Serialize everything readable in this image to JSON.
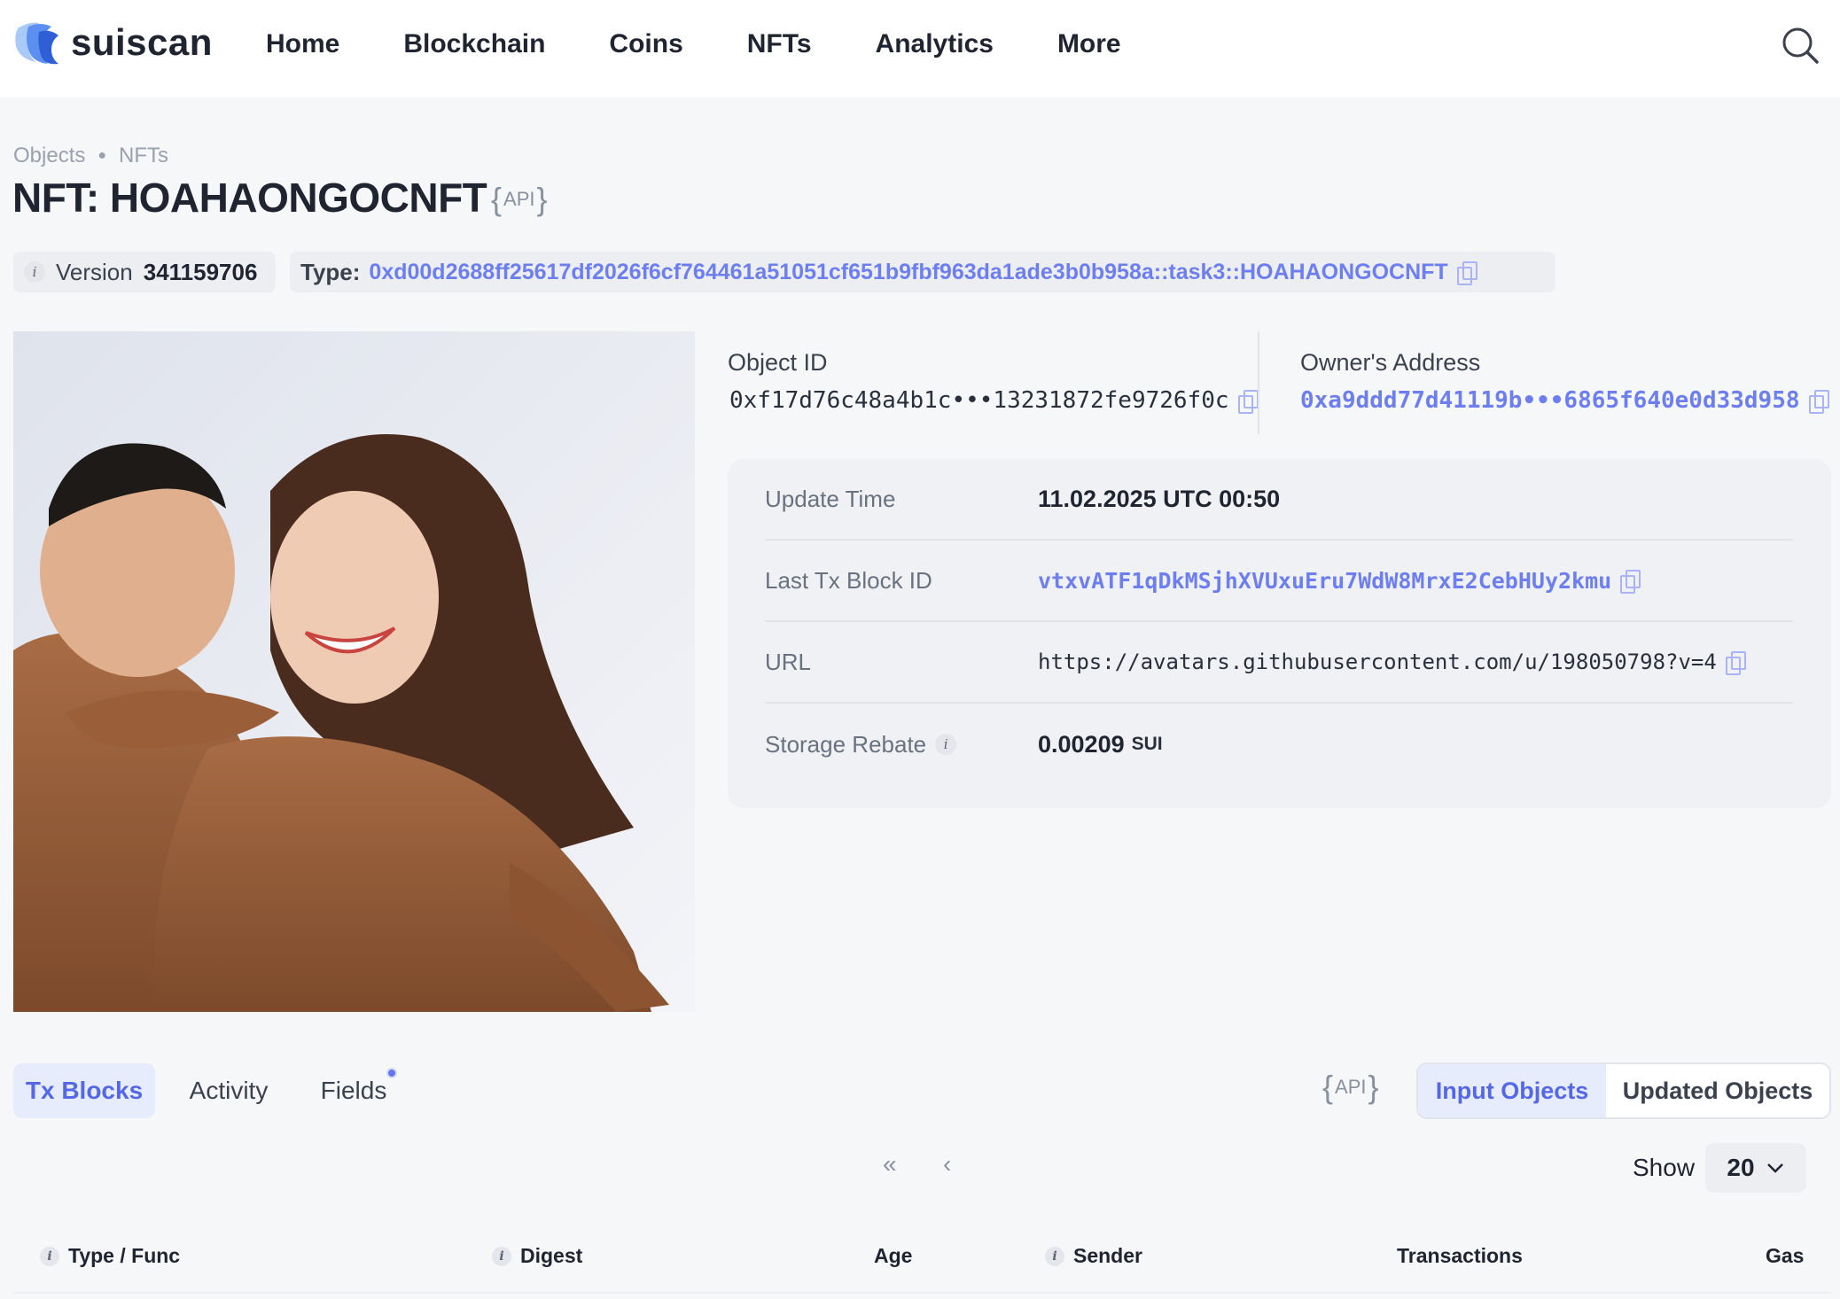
{
  "header": {
    "brand": "suiscan",
    "nav": [
      "Home",
      "Blockchain",
      "Coins",
      "NFTs",
      "Analytics",
      "More"
    ]
  },
  "breadcrumb": [
    "Objects",
    "NFTs"
  ],
  "title": "NFT: HOAHAONGOCNFT",
  "api_label": "API",
  "version": {
    "label": "Version",
    "value": "341159706"
  },
  "type": {
    "label": "Type:",
    "value": "0xd00d2688ff25617df2026f6cf764461a51051cf651b9fbf963da1ade3b0b958a::task3::HOAHAONGOCNFT"
  },
  "object_id": {
    "label": "Object ID",
    "value": "0xf17d76c48a4b1c•••13231872fe9726f0c"
  },
  "owner": {
    "label": "Owner's Address",
    "value": "0xa9ddd77d41119b•••6865f640e0d33d958"
  },
  "details": {
    "update_time": {
      "label": "Update Time",
      "value": "11.02.2025 UTC 00:50"
    },
    "last_tx": {
      "label": "Last Tx Block ID",
      "value": "vtxvATF1qDkMSjhXVUxuEru7WdW8MrxE2CebHUy2kmu"
    },
    "url": {
      "label": "URL",
      "value": "https://avatars.githubusercontent.com/u/198050798?v=4"
    },
    "storage_rebate": {
      "label": "Storage Rebate",
      "value": "0.00209",
      "unit": "SUI"
    }
  },
  "tabs": [
    "Tx Blocks",
    "Activity",
    "Fields"
  ],
  "segments": [
    "Input Objects",
    "Updated Objects"
  ],
  "pagination": {
    "first": "«",
    "prev": "‹"
  },
  "show": {
    "label": "Show",
    "value": "20"
  },
  "table_headers": [
    "Type / Func",
    "Digest",
    "Age",
    "Sender",
    "Transactions",
    "Gas"
  ],
  "colors": {
    "link": "#6d7ff0",
    "accent": "#5468e6",
    "active_bg": "#e7ecfd"
  },
  "icons": [
    "search-icon",
    "copy-icon",
    "info-icon",
    "chevron-down-icon"
  ]
}
